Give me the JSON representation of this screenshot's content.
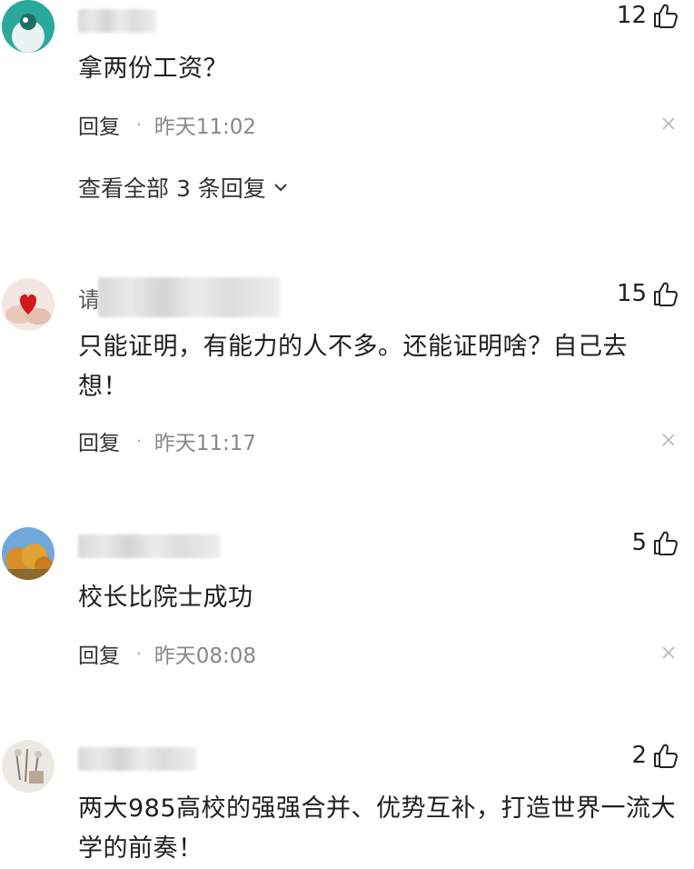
{
  "comments": [
    {
      "username_visible": "",
      "like_count": "12",
      "text": "拿两份工资？",
      "reply_label": "回复",
      "time": "昨天11:02",
      "view_replies": "查看全部 3 条回复"
    },
    {
      "username_visible": "请",
      "like_count": "15",
      "text": "只能证明，有能力的人不多。还能证明啥？自己去想！",
      "reply_label": "回复",
      "time": "昨天11:17"
    },
    {
      "username_visible": "",
      "like_count": "5",
      "text": "校长比院士成功",
      "reply_label": "回复",
      "time": "昨天08:08"
    },
    {
      "username_visible": "",
      "like_count": "2",
      "text": "两大985高校的强强合并、优势互补，打造世界一流大学的前奏！"
    }
  ],
  "icons": {
    "like": "thumbs-up-icon",
    "close": "close-icon",
    "expand": "chevron-down-icon"
  },
  "colors": {
    "text": "#1f1f1f",
    "muted": "#888888",
    "close": "#bbbbbb"
  }
}
